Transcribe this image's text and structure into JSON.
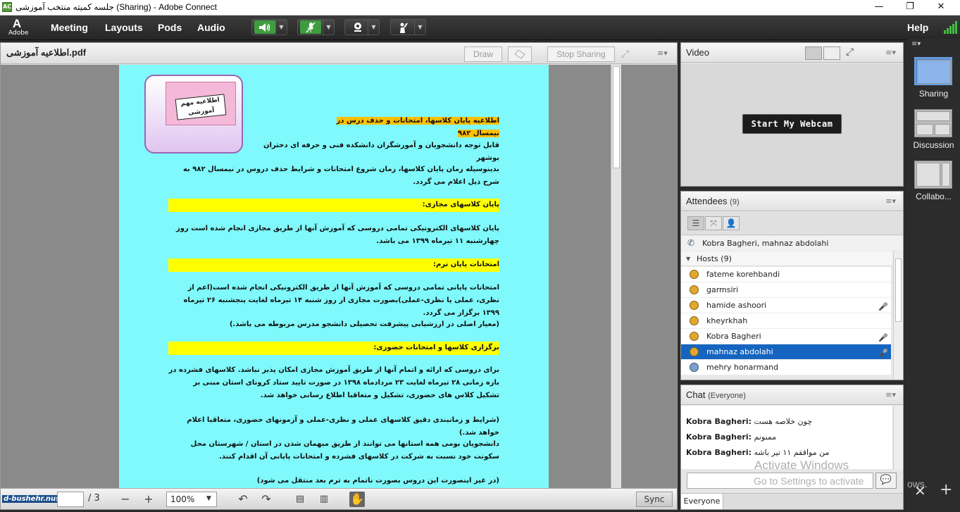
{
  "window": {
    "title": "جلسه کمیته منتخب آموزشی (Sharing) - Adobe Connect",
    "min": "—",
    "max": "❐",
    "close": "✕",
    "app_icon": "AC"
  },
  "logo": {
    "glyph": "A",
    "text": "Adobe"
  },
  "menu": [
    "Meeting",
    "Layouts",
    "Pods",
    "Audio"
  ],
  "help": "Help",
  "icons": {
    "speaker": "speaker-icon",
    "mic": "microphone-muted-icon",
    "camera": "webcam-icon",
    "raise_hand": "raise-hand-icon",
    "dropdown": "chevron-down-icon",
    "signal": "connection-signal-icon"
  },
  "share": {
    "doc_name": "اطلاعیه آموزشی.pdf",
    "draw": "Draw",
    "stop_sharing": "Stop Sharing",
    "page_of": "/ 3",
    "page_value": "",
    "zoom": "100%",
    "sync": "Sync",
    "watermark": "d-bushehr.nus.ac.ir"
  },
  "doc": {
    "notice_title": "اطلاعیه مهم آموزشی",
    "heading": "اطلاعیه پایان کلاسها، امتحانات و حذف درس در نیمسال ۹۸۲",
    "p1": "قابل توجه دانشجویان و آموزشگران دانشکده فنی و حرفه ای دختران بوشهر",
    "p2": "بدینوسیله زمان پایان کلاسها، زمان شروع امتحانات و شرایط حذف دروس در  نیمسال ۹۸۲ به شرح ذیل اعلام می گردد.",
    "h1": "پایان کلاسهای مجازی:",
    "p3": "پایان کلاسهای الکترونیکی تمامی دروسی که آموزش آنها از طریق مجازی انجام شده است روز چهارشنبه ۱۱ تیرماه ۱۳۹۹ می باشد.",
    "h2": "امتحانات پایان ترم:",
    "p4": "امتحانات پایانی تمامی دروسی که آموزش آنها از طریق الکترونیکی انجام شده است(اعم از نظری، عملی یا نظری-عملی)بصورت مجازی از روز شنبه ۱۴ تیرماه لغایت پنجشنبه ۲۶ تیرماه ۱۳۹۹ برگزار می گردد.",
    "p5": "(معیار اصلی در ارزشیابی پیشرفت تحصیلی دانشجو مدرس مربوطه می باشد.)",
    "h3": "برگزاری کلاسها و امتحانات حضوری:",
    "p6": "برای دروسی که ارائه و اتمام آنها از طریق آموزش مجازی امکان پذیر نباشد. کلاسهای فشرده در بازه زمانی ۲۸ تیرماه لغایت ۲۳ مردادماه ۱۳۹۸ در صورت تایید ستاد کرونای استان مبنی بر تشکیل کلاس های حضوری، تشکیل و متعاقبا اطلاع رسانی خواهد شد.",
    "p7": "(شرایط و زمانبندی دقیق کلاسهای عملی و نظری-عملی و آزمونهای حضوری، متعاقبا اعلام خواهد شد.)",
    "p8": "دانشجویان بومی همه استانها می توانند از طریق میهمان شدن در استان / شهرستان محل سکونت خود نسبت به شرکت در کلاسهای فشرده و امتحانات پایانی آن اقدام کنند.",
    "p9": "(در غیر اینصورت این دروس بصورت ناتمام به ترم بعد منتقل می شود)"
  },
  "video": {
    "title": "Video",
    "start": "Start My Webcam"
  },
  "attendees": {
    "title": "Attendees",
    "count": "(9)",
    "speaking": "Kobra Bagheri, mahnaz abdolahi",
    "group": "Hosts (9)",
    "list": [
      {
        "name": "fateme korehbandi",
        "status": ""
      },
      {
        "name": "garmsiri",
        "status": ""
      },
      {
        "name": "hamide ashoori",
        "status": "🎤"
      },
      {
        "name": "kheyrkhah",
        "status": ""
      },
      {
        "name": "Kobra Bagheri",
        "status": "🎤"
      },
      {
        "name": "mahnaz abdolahi",
        "status": "🎤"
      },
      {
        "name": "mehry honarmand",
        "status": ""
      }
    ]
  },
  "chat": {
    "title": "Chat",
    "scope": "(Everyone)",
    "messages": [
      {
        "from": "Kobra Bagheri:",
        "text": "چون خلاصه هست"
      },
      {
        "from": "Kobra Bagheri:",
        "text": "ممنونم"
      },
      {
        "from": "Kobra Bagheri:",
        "text": "من موافقم ۱۱ تیر باشه"
      }
    ],
    "to": "Everyone",
    "activate1": "Activate Windows",
    "activate2": "Go to Settings to activate",
    "activate3": "ows."
  },
  "layouts": [
    "Sharing",
    "Discussion",
    "Collabo..."
  ]
}
